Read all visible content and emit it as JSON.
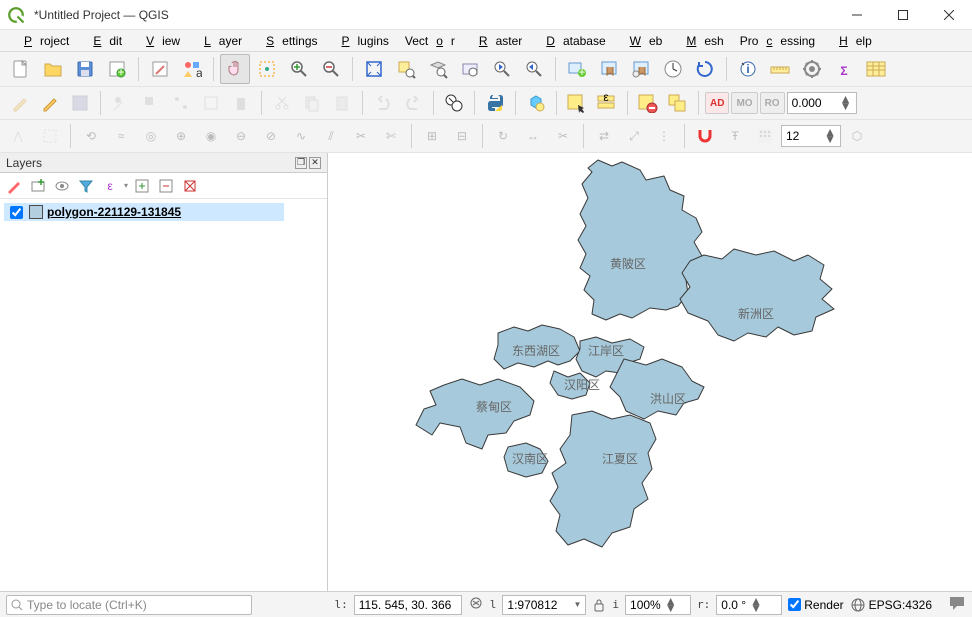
{
  "title": "*Untitled Project — QGIS",
  "menu": [
    "Project",
    "Edit",
    "View",
    "Layer",
    "Settings",
    "Plugins",
    "Vector",
    "Raster",
    "Database",
    "Web",
    "Mesh",
    "Processing",
    "Help"
  ],
  "toolbar_row3": {
    "spin_value": "0.000"
  },
  "toolbar_row4": {
    "spin_value": "12"
  },
  "layers_panel": {
    "title": "Layers",
    "layer": {
      "checked": true,
      "name": "polygon-221129-131845",
      "fill": "#a6c9db"
    }
  },
  "map": {
    "labels": [
      "黄陂区",
      "新洲区",
      "东西湖区",
      "江岸区",
      "汉阳区",
      "蔡甸区",
      "洪山区",
      "汉南区",
      "江夏区"
    ]
  },
  "status": {
    "locate_placeholder": "Type to locate (Ctrl+K)",
    "coord_label": "l:",
    "coord": "115. 545, 30. 366",
    "scale_label": "l",
    "scale": "1:970812",
    "mag_label": "i",
    "magnifier": "100%",
    "rot_label": "r:",
    "rotation": "0.0 °",
    "render_label": "Render",
    "render_checked": true,
    "crs": "EPSG:4326"
  }
}
